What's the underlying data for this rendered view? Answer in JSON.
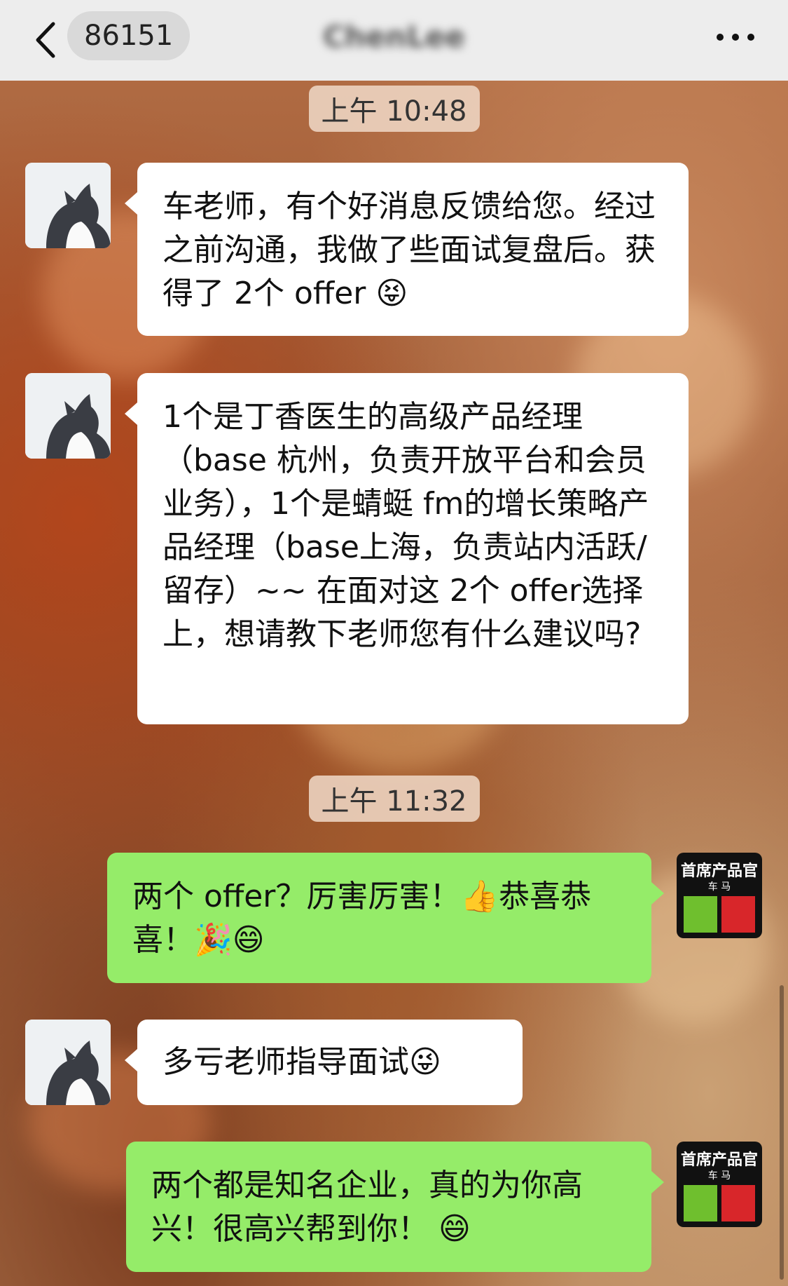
{
  "header": {
    "back_label": "86151",
    "title": "ChenLee"
  },
  "messages": [
    {
      "type": "time",
      "text": "上午 10:48"
    },
    {
      "type": "received",
      "text": "车老师，有个好消息反馈给您。经过之前沟通，我做了些面试复盘后。获得了 2个 offer 😝"
    },
    {
      "type": "received",
      "text": "1个是丁香医生的高级产品经理（base 杭州，负责开放平台和会员业务），1个是蜻蜓 fm的增长策略产品经理（base上海，负责站内活跃/留存）~~ 在面对这 2个 offer选择上，想请教下老师您有什么建议吗?"
    },
    {
      "type": "time",
      "text": "上午 11:32"
    },
    {
      "type": "sent",
      "text": "两个 offer？厉害厉害！👍恭喜恭喜！🎉😄"
    },
    {
      "type": "received",
      "text": "多亏老师指导面试😜"
    },
    {
      "type": "sent",
      "text": "两个都是知名企业，真的为你高兴！很高兴帮到你！ 😄"
    }
  ],
  "my_avatar": {
    "title": "首席产品官",
    "subtitle": "车 马"
  },
  "colors": {
    "sent_bubble": "#95ec69",
    "received_bubble": "#ffffff",
    "header_bg": "#ededed"
  }
}
